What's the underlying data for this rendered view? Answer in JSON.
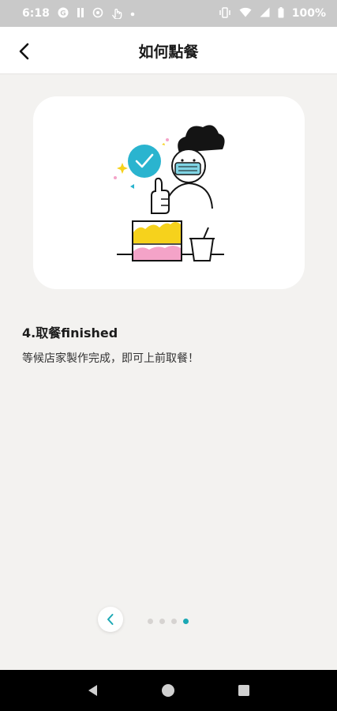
{
  "status_bar": {
    "time": "6:18",
    "battery_text": "100%"
  },
  "header": {
    "title": "如何點餐"
  },
  "step": {
    "title": "4.取餐finished",
    "description": "等候店家製作完成，即可上前取餐！"
  },
  "pager": {
    "total": 4,
    "current": 4
  },
  "colors": {
    "accent": "#1ba8b4",
    "check_circle": "#2ab4cf",
    "yellow": "#f6d21c",
    "pink": "#f4a3c8",
    "mask": "#7fd3e3",
    "background": "#f3f2f0"
  },
  "icons": {
    "back": "chevron-left-icon",
    "prev": "chevron-left-icon",
    "nav_back": "triangle-back-icon",
    "nav_home": "circle-home-icon",
    "nav_recents": "square-recents-icon"
  }
}
